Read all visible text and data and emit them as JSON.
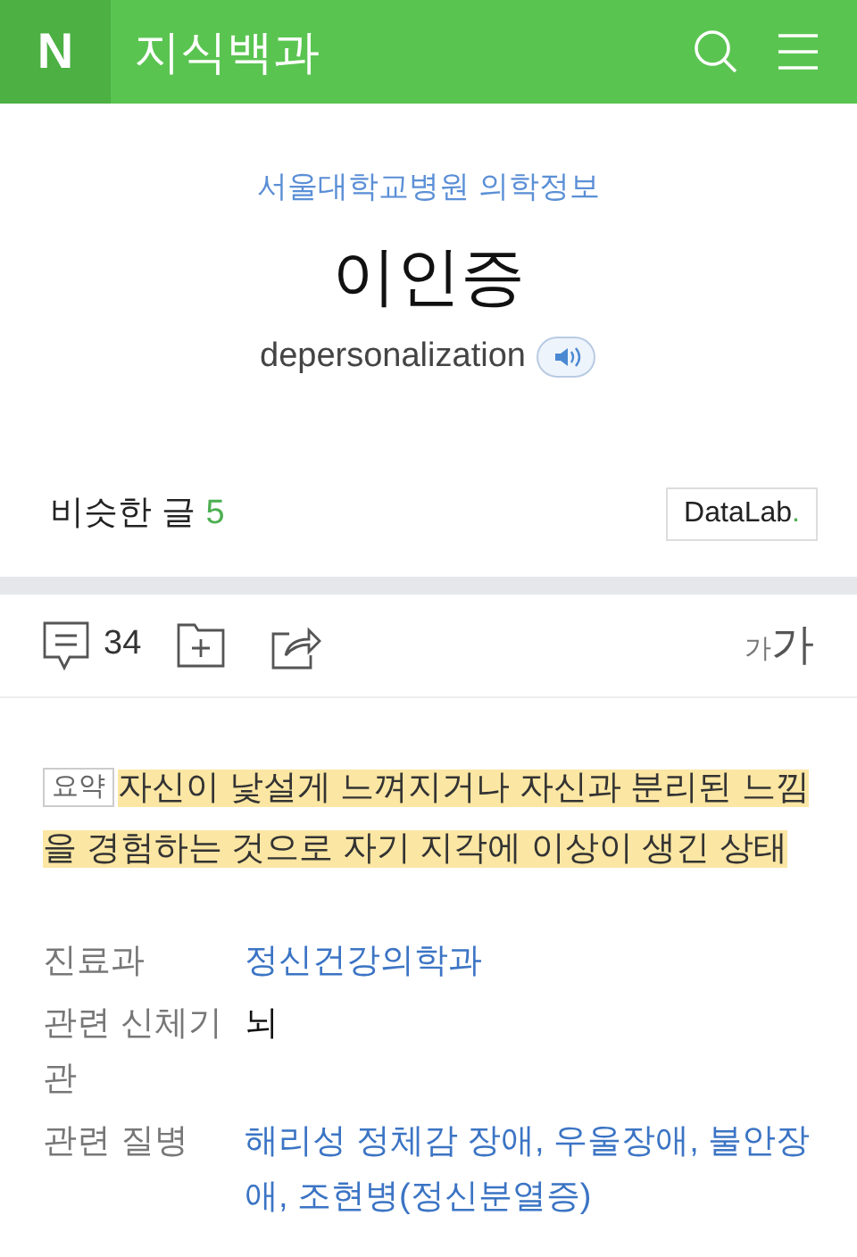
{
  "header": {
    "logo": "N",
    "title": "지식백과"
  },
  "article": {
    "source": "서울대학교병원 의학정보",
    "title": "이인증",
    "subtitle": "depersonalization"
  },
  "similar": {
    "label": "비슷한 글",
    "count": "5",
    "datalab": "DataLab",
    "datalab_dot": "."
  },
  "actions": {
    "comments": "34",
    "font_small": "가",
    "font_large": "가"
  },
  "summary": {
    "tag": "요약",
    "text": "자신이 낯설게 느껴지거나 자신과 분리된 느낌을 경험하는 것으로 자기 지각에 이상이 생긴 상태"
  },
  "fields": [
    {
      "label": "진료과",
      "value": "정신건강의학과",
      "kind": "link"
    },
    {
      "label": "관련 신체기관",
      "value": "뇌",
      "kind": "text"
    },
    {
      "label": "관련 질병",
      "value": "해리성 정체감 장애, 우울장애, 불안장애, 조현병(정신분열증)",
      "kind": "link"
    }
  ]
}
